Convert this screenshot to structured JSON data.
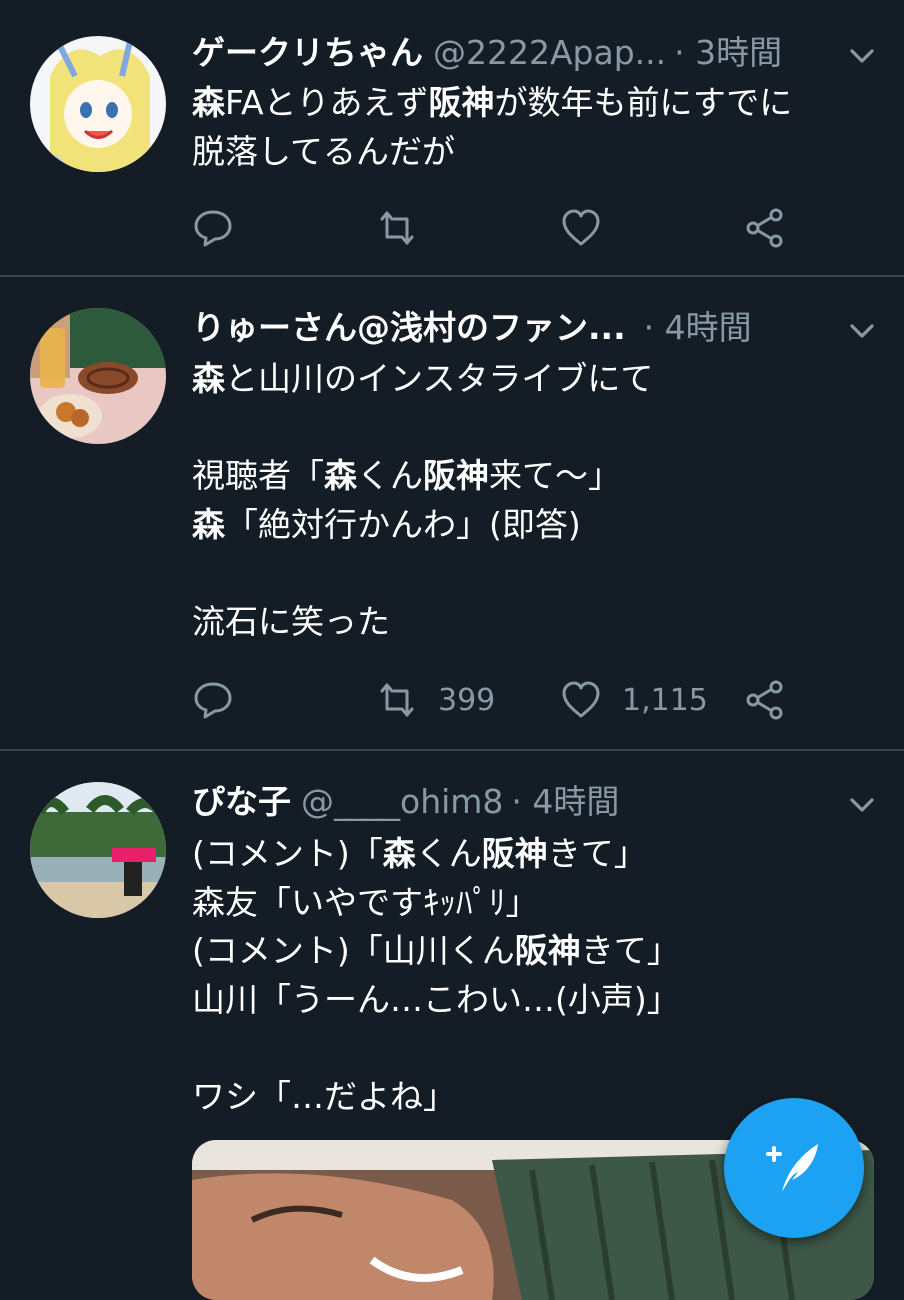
{
  "tweets": [
    {
      "name": "ゲークリちゃん",
      "handle": "@2222Apap...",
      "time": "· 3時間",
      "lines": [
        [
          {
            "t": "森",
            "b": true
          },
          {
            "t": "FAとりあえず",
            "b": false
          },
          {
            "t": "阪神",
            "b": true
          },
          {
            "t": "が数年も前にすでに",
            "b": false
          }
        ],
        [
          {
            "t": "脱落してるんだが",
            "b": false
          }
        ]
      ],
      "retweets": "",
      "likes": ""
    },
    {
      "name": "りゅーさん@浅村のファン...",
      "handle": "",
      "time": "· 4時間",
      "lines": [
        [
          {
            "t": "森",
            "b": true
          },
          {
            "t": "と山川のインスタライブにて",
            "b": false
          }
        ],
        [],
        [
          {
            "t": "視聴者「",
            "b": false
          },
          {
            "t": "森",
            "b": true
          },
          {
            "t": "くん",
            "b": false
          },
          {
            "t": "阪神",
            "b": true
          },
          {
            "t": "来て～」",
            "b": false
          }
        ],
        [
          {
            "t": "森",
            "b": true
          },
          {
            "t": "「絶対行かんわ」(即答)",
            "b": false
          }
        ],
        [],
        [
          {
            "t": "流石に笑った",
            "b": false
          }
        ]
      ],
      "retweets": "399",
      "likes": "1,115"
    },
    {
      "name": "ぴな子",
      "handle": "@____ohim8",
      "time": "· 4時間",
      "lines": [
        [
          {
            "t": "(コメント)「",
            "b": false
          },
          {
            "t": "森",
            "b": true
          },
          {
            "t": "くん",
            "b": false
          },
          {
            "t": "阪神",
            "b": true
          },
          {
            "t": "きて」",
            "b": false
          }
        ],
        [
          {
            "t": "森友「いやですｷｯﾊﾟﾘ」",
            "b": false
          }
        ],
        [
          {
            "t": "(コメント)「山川くん",
            "b": false
          },
          {
            "t": "阪神",
            "b": true
          },
          {
            "t": "きて」",
            "b": false
          }
        ],
        [
          {
            "t": "山川「うーん…こわい…(小声)」",
            "b": false
          }
        ],
        [],
        [
          {
            "t": "ワシ「…だよね」",
            "b": false
          }
        ]
      ],
      "retweets": "",
      "likes": ""
    }
  ],
  "icons": {
    "reply": "reply-icon",
    "retweet": "retweet-icon",
    "like": "heart-icon",
    "share": "share-icon",
    "more": "chevron-down-icon",
    "compose": "compose-tweet-icon"
  },
  "colors": {
    "background": "#141d26",
    "muted": "#8899a6",
    "divider": "#38444d",
    "accent": "#1da1f2"
  }
}
